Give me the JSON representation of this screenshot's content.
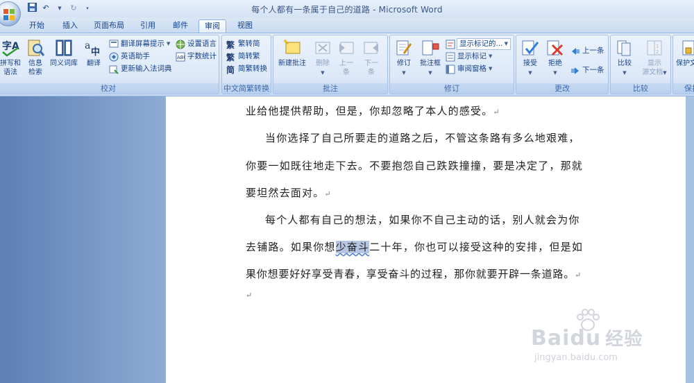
{
  "window": {
    "title": "每个人都有一条属于自己的道路 - Microsoft Word"
  },
  "tabs": [
    "开始",
    "插入",
    "页面布局",
    "引用",
    "邮件",
    "审阅",
    "视图"
  ],
  "ribbon": {
    "proofing": {
      "label": "校对",
      "spelling": [
        "拼写和",
        "语法"
      ],
      "research": [
        "信息",
        "检索"
      ],
      "thesaurus": "同义词库",
      "translate": "翻译",
      "translate_tip": "翻译屏幕提示",
      "english_assistant": "英语助手",
      "update_ime": "更新输入法词典",
      "set_language": "设置语言",
      "word_count": "字数统计"
    },
    "chinese_conv": {
      "label": "中文简繁转换",
      "to_simplified": "繁转简",
      "to_traditional": "简转繁",
      "conversion": "简繁转换"
    },
    "comments": {
      "label": "批注",
      "new": "新建批注",
      "delete": "删除",
      "prev": [
        "上一",
        "条"
      ],
      "next": [
        "下一",
        "条"
      ]
    },
    "tracking": {
      "label": "修订",
      "track": "修订",
      "balloons": "批注框",
      "display_combo": "显示标记的...",
      "show_markup": "显示标记",
      "reviewing_pane": "审阅窗格"
    },
    "changes": {
      "label": "更改",
      "accept": "接受",
      "reject": "拒绝",
      "prev": "上一条",
      "next": "下一条"
    },
    "compare": {
      "label": "比较",
      "compare": "比较",
      "show_source": [
        "显示",
        "源文档"
      ]
    },
    "protect": {
      "label": "保护",
      "protect_doc": "保护文"
    }
  },
  "document": {
    "line1": "业给他提供帮助，但是，你却忽略了本人的感受。",
    "line2": "当你选择了自己所要走的道路之后，不管这条路有多么地艰难，",
    "line3": "你要一如既往地走下去。不要抱怨自己跌跌撞撞，要是决定了，那就",
    "line4": "要坦然去面对。",
    "line5": "每个人都有自己的想法，如果你不自己主动的话，别人就会为你",
    "line6_a": "去铺路。如果你想",
    "line6_hl": "少奋斗",
    "line6_b": "二十年，你也可以接受这种的安排，但是如",
    "line7": "果你想要好好享受青春，享受奋斗的过程，那你就要开辟一条道路。",
    "para_mark": "↵"
  },
  "watermark": {
    "brand": "Baidu",
    "brand_cn": "经验",
    "url": "jingyan.baidu.com"
  }
}
